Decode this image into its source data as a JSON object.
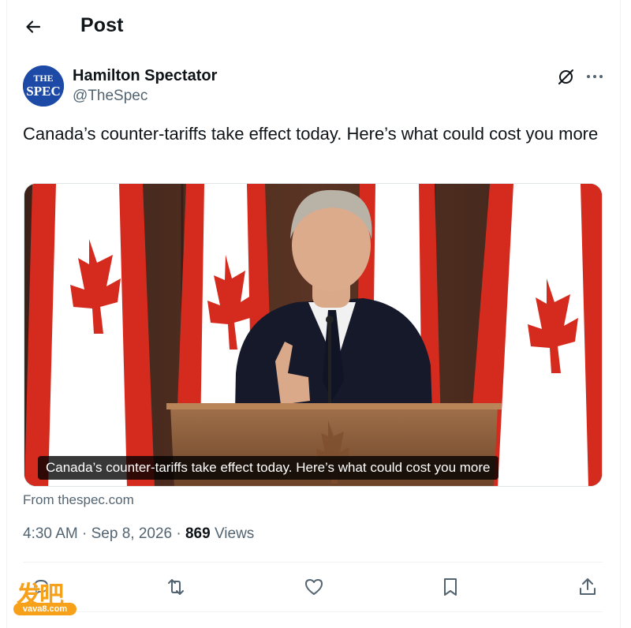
{
  "header": {
    "back_icon": "arrow-left-icon",
    "title": "Post"
  },
  "author": {
    "avatar_text_top": "THE",
    "avatar_text_bottom": "SPEC",
    "name": "Hamilton Spectator",
    "handle": "@TheSpec",
    "grok_icon": "grok-slash-icon",
    "more_icon": "more-horizontal-icon"
  },
  "post": {
    "text": "Canada’s counter-tariffs take effect today. Here’s what could cost you more"
  },
  "media": {
    "caption": "Canada’s counter-tariffs take effect today. Here’s what could cost you more",
    "source": "From thespec.com"
  },
  "meta": {
    "time": "4:30 AM",
    "separator": "·",
    "date": "Sep 8, 2026",
    "views_count": "869",
    "views_label": "Views"
  },
  "actions": [
    {
      "name": "reply",
      "icon": "reply-bubble-icon"
    },
    {
      "name": "repost",
      "icon": "repost-icon"
    },
    {
      "name": "like",
      "icon": "heart-icon"
    },
    {
      "name": "bookmark",
      "icon": "bookmark-icon"
    },
    {
      "name": "share",
      "icon": "share-upload-icon"
    }
  ],
  "watermark": {
    "glyphs": "发吧",
    "url": "vava8.com"
  },
  "colors": {
    "text_primary": "#0f1419",
    "text_secondary": "#536471",
    "divider": "#eff3f4",
    "avatar_bg": "#1d4aa6",
    "flag_red": "#d52b1e",
    "watermark_orange": "#f7a11a"
  }
}
